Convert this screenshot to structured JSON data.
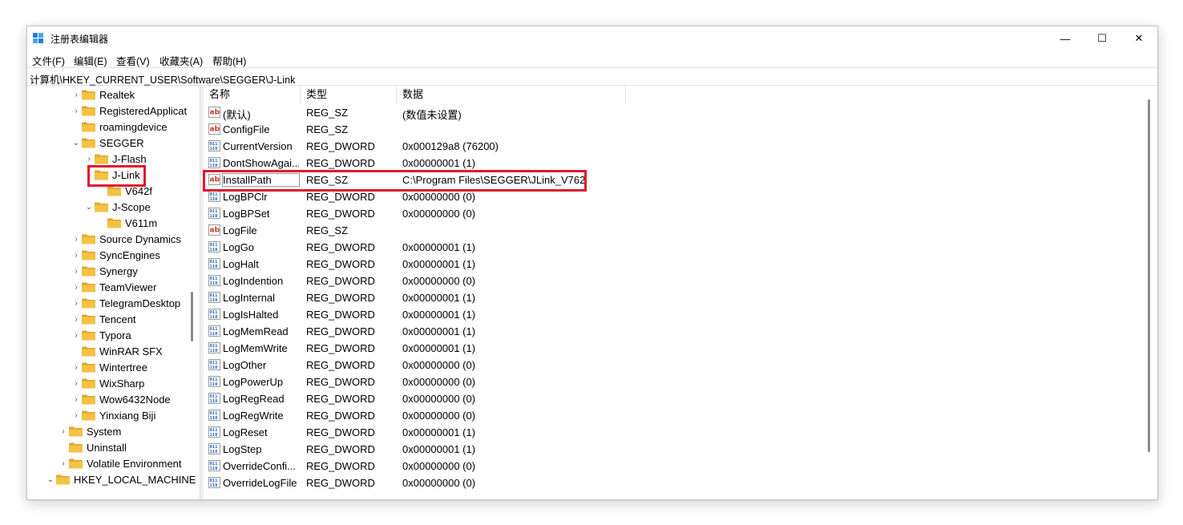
{
  "window": {
    "title": "注册表编辑器",
    "buttons": {
      "minimize": "—",
      "maximize": "☐",
      "close": "✕"
    }
  },
  "menu": [
    "文件(F)",
    "编辑(E)",
    "查看(V)",
    "收藏夹(A)",
    "帮助(H)"
  ],
  "address": "计算机\\HKEY_CURRENT_USER\\Software\\SEGGER\\J-Link",
  "tree": [
    {
      "label": "Realtek",
      "chevron": "›"
    },
    {
      "label": "RegisteredApplicat",
      "chevron": "›"
    },
    {
      "label": "roamingdevice",
      "chevron": ""
    },
    {
      "label": "SEGGER",
      "chevron": "⌄"
    },
    {
      "label": "J-Flash",
      "chevron": "›"
    },
    {
      "label": "J-Link",
      "chevron": "⌄"
    },
    {
      "label": "V642f",
      "chevron": ""
    },
    {
      "label": "J-Scope",
      "chevron": "⌄"
    },
    {
      "label": "V611m",
      "chevron": ""
    },
    {
      "label": "Source Dynamics",
      "chevron": "›"
    },
    {
      "label": "SyncEngines",
      "chevron": "›"
    },
    {
      "label": "Synergy",
      "chevron": "›"
    },
    {
      "label": "TeamViewer",
      "chevron": "›"
    },
    {
      "label": "TelegramDesktop",
      "chevron": "›"
    },
    {
      "label": "Tencent",
      "chevron": "›"
    },
    {
      "label": "Typora",
      "chevron": "›"
    },
    {
      "label": "WinRAR SFX",
      "chevron": ""
    },
    {
      "label": "Wintertree",
      "chevron": "›"
    },
    {
      "label": "WixSharp",
      "chevron": "›"
    },
    {
      "label": "Wow6432Node",
      "chevron": "›"
    },
    {
      "label": "Yinxiang Biji",
      "chevron": "›"
    },
    {
      "label": "System",
      "chevron": "›"
    },
    {
      "label": "Uninstall",
      "chevron": ""
    },
    {
      "label": "Volatile Environment",
      "chevron": "›"
    },
    {
      "label": "HKEY_LOCAL_MACHINE",
      "chevron": "⌄"
    }
  ],
  "columns": {
    "name": "名称",
    "type": "类型",
    "data": "数据"
  },
  "values": [
    {
      "icon": "string",
      "name": "(默认)",
      "type": "REG_SZ",
      "data": "(数值未设置)"
    },
    {
      "icon": "string",
      "name": "ConfigFile",
      "type": "REG_SZ",
      "data": ""
    },
    {
      "icon": "dword",
      "name": "CurrentVersion",
      "type": "REG_DWORD",
      "data": "0x000129a8 (76200)"
    },
    {
      "icon": "dword",
      "name": "DontShowAgai...",
      "type": "REG_DWORD",
      "data": "0x00000001 (1)"
    },
    {
      "icon": "string",
      "name": "InstallPath",
      "type": "REG_SZ",
      "data": "C:\\Program Files\\SEGGER\\JLink_V762"
    },
    {
      "icon": "dword",
      "name": "LogBPClr",
      "type": "REG_DWORD",
      "data": "0x00000000 (0)"
    },
    {
      "icon": "dword",
      "name": "LogBPSet",
      "type": "REG_DWORD",
      "data": "0x00000000 (0)"
    },
    {
      "icon": "string",
      "name": "LogFile",
      "type": "REG_SZ",
      "data": ""
    },
    {
      "icon": "dword",
      "name": "LogGo",
      "type": "REG_DWORD",
      "data": "0x00000001 (1)"
    },
    {
      "icon": "dword",
      "name": "LogHalt",
      "type": "REG_DWORD",
      "data": "0x00000001 (1)"
    },
    {
      "icon": "dword",
      "name": "LogIndention",
      "type": "REG_DWORD",
      "data": "0x00000000 (0)"
    },
    {
      "icon": "dword",
      "name": "LogInternal",
      "type": "REG_DWORD",
      "data": "0x00000001 (1)"
    },
    {
      "icon": "dword",
      "name": "LogIsHalted",
      "type": "REG_DWORD",
      "data": "0x00000001 (1)"
    },
    {
      "icon": "dword",
      "name": "LogMemRead",
      "type": "REG_DWORD",
      "data": "0x00000001 (1)"
    },
    {
      "icon": "dword",
      "name": "LogMemWrite",
      "type": "REG_DWORD",
      "data": "0x00000001 (1)"
    },
    {
      "icon": "dword",
      "name": "LogOther",
      "type": "REG_DWORD",
      "data": "0x00000000 (0)"
    },
    {
      "icon": "dword",
      "name": "LogPowerUp",
      "type": "REG_DWORD",
      "data": "0x00000000 (0)"
    },
    {
      "icon": "dword",
      "name": "LogRegRead",
      "type": "REG_DWORD",
      "data": "0x00000000 (0)"
    },
    {
      "icon": "dword",
      "name": "LogRegWrite",
      "type": "REG_DWORD",
      "data": "0x00000000 (0)"
    },
    {
      "icon": "dword",
      "name": "LogReset",
      "type": "REG_DWORD",
      "data": "0x00000001 (1)"
    },
    {
      "icon": "dword",
      "name": "LogStep",
      "type": "REG_DWORD",
      "data": "0x00000001 (1)"
    },
    {
      "icon": "dword",
      "name": "OverrideConfi...",
      "type": "REG_DWORD",
      "data": "0x00000000 (0)"
    },
    {
      "icon": "dword",
      "name": "OverrideLogFile",
      "type": "REG_DWORD",
      "data": "0x00000000 (0)"
    }
  ],
  "colors": {
    "highlight": "#e0182d",
    "folder": "#f3c244",
    "folder_dark": "#e0a72a"
  }
}
